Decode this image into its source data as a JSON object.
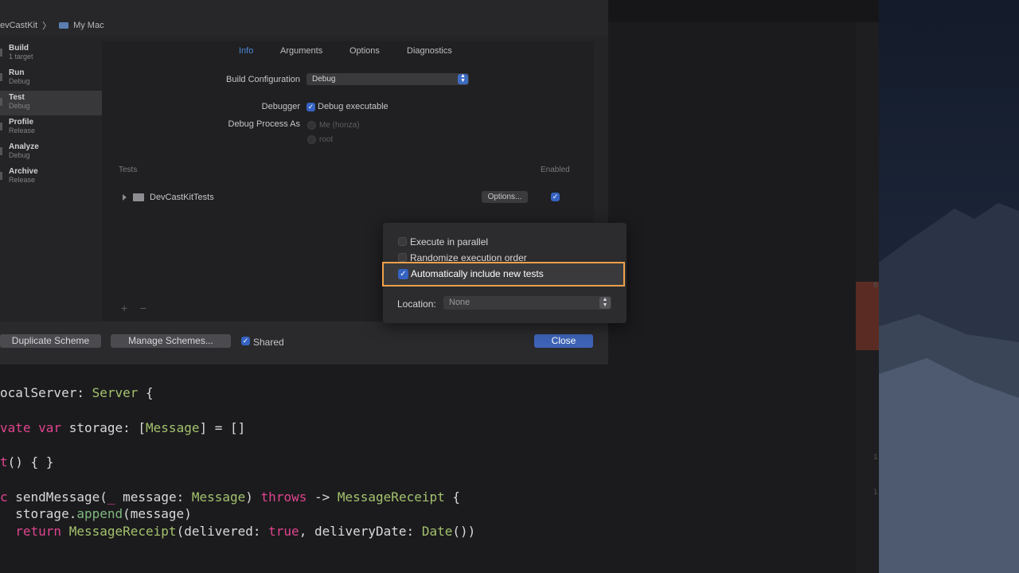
{
  "breadcrumb": {
    "project": "evCastKit",
    "separator": "〉",
    "destination": "My Mac"
  },
  "sidebar": {
    "items": [
      {
        "title": "Build",
        "subtitle": "1 target"
      },
      {
        "title": "Run",
        "subtitle": "Debug"
      },
      {
        "title": "Test",
        "subtitle": "Debug"
      },
      {
        "title": "Profile",
        "subtitle": "Release"
      },
      {
        "title": "Analyze",
        "subtitle": "Debug"
      },
      {
        "title": "Archive",
        "subtitle": "Release"
      }
    ]
  },
  "tabs": [
    "Info",
    "Arguments",
    "Options",
    "Diagnostics"
  ],
  "info": {
    "build_config_label": "Build Configuration",
    "build_config_value": "Debug",
    "debugger_label": "Debugger",
    "debugger_value": "Debug executable",
    "debug_process_label": "Debug Process As",
    "debug_process_options": [
      "Me (honza)",
      "root"
    ]
  },
  "tests": {
    "header_tests": "Tests",
    "header_enabled": "Enabled",
    "row_name": "DevCastKitTests",
    "options_button": "Options...",
    "add_symbol": "+",
    "remove_symbol": "−"
  },
  "bottom": {
    "duplicate": "Duplicate Scheme",
    "manage": "Manage Schemes...",
    "shared": "Shared",
    "close": "Close"
  },
  "popover": {
    "opt_parallel": "Execute in parallel",
    "opt_randomize": "Randomize execution order",
    "opt_auto": "Automatically include new tests",
    "location_label": "Location:",
    "location_value": "None"
  },
  "gutter_numbers": [
    "0",
    "1",
    "1"
  ],
  "colors": {
    "accent": "#3563c2",
    "highlight": "#f0a04a",
    "keyword": "#e0448e",
    "type": "#a4c26e"
  }
}
